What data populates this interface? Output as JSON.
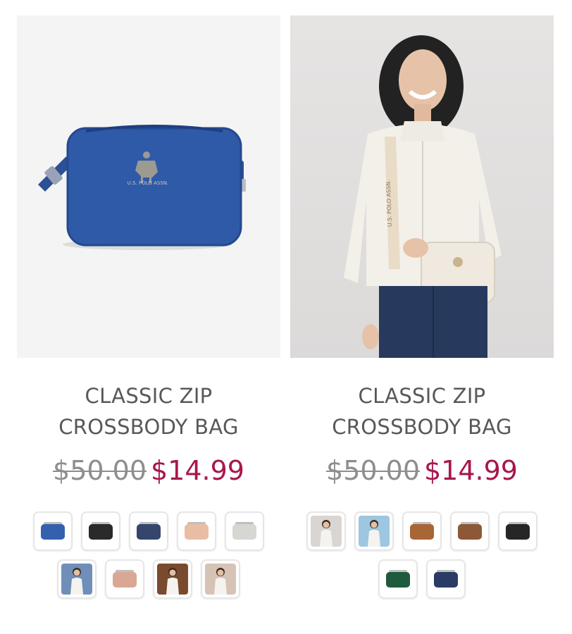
{
  "products": [
    {
      "title_line1": "CLASSIC ZIP",
      "title_line2": "CROSSBODY BAG",
      "old_price": "$50.00",
      "sale_price": "$14.99",
      "logo_text": "U.S. POLO ASSN.",
      "main_color": "#2f5aa8",
      "swatches": [
        {
          "name": "blue",
          "kind": "bag",
          "color": "#3560ae"
        },
        {
          "name": "black",
          "kind": "bag",
          "color": "#2a2a2a"
        },
        {
          "name": "navy",
          "kind": "bag",
          "color": "#34466e"
        },
        {
          "name": "blush",
          "kind": "bag",
          "color": "#e9bda4"
        },
        {
          "name": "light-grey",
          "kind": "bag",
          "color": "#d6d6d2"
        },
        {
          "name": "model-denim",
          "kind": "person",
          "color": "#6f8fb8"
        },
        {
          "name": "dusty-pink",
          "kind": "bag",
          "color": "#d8a894"
        },
        {
          "name": "model-brown",
          "kind": "person",
          "color": "#7a4a2e"
        },
        {
          "name": "model-red",
          "kind": "person",
          "color": "#d7c2b6"
        }
      ]
    },
    {
      "title_line1": "CLASSIC ZIP",
      "title_line2": "CROSSBODY BAG",
      "old_price": "$50.00",
      "sale_price": "$14.99",
      "strap_text": "U.S. POLO ASSN.",
      "main_color": "#efe9df",
      "swatches": [
        {
          "name": "model-cream",
          "kind": "person",
          "color": "#d9d5d1"
        },
        {
          "name": "model-blue",
          "kind": "person",
          "color": "#9dc6e0"
        },
        {
          "name": "cognac",
          "kind": "bag",
          "color": "#a86535"
        },
        {
          "name": "brown",
          "kind": "bag",
          "color": "#8d5836"
        },
        {
          "name": "black",
          "kind": "bag",
          "color": "#262626"
        },
        {
          "name": "green",
          "kind": "bag",
          "color": "#1f5a3c"
        },
        {
          "name": "navy",
          "kind": "bag",
          "color": "#2a3b66"
        }
      ]
    }
  ]
}
